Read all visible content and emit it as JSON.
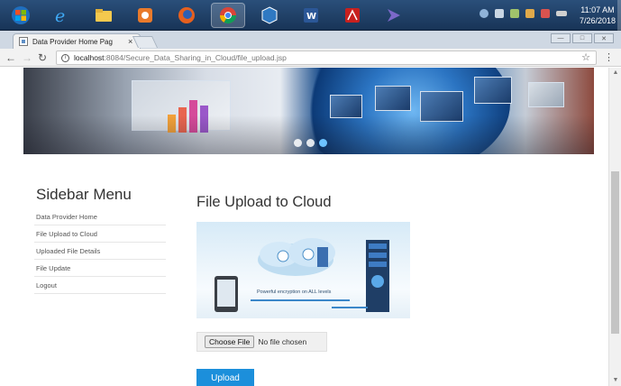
{
  "taskbar": {
    "clock_time": "11:07 AM",
    "clock_date": "7/26/2018"
  },
  "browser": {
    "tab_title": "Data Provider Home Pag",
    "tab_close": "×",
    "url_host": "localhost",
    "url_path": ":8084/Secure_Data_Sharing_in_Cloud/file_upload.jsp"
  },
  "sidebar": {
    "title": "Sidebar Menu",
    "items": [
      {
        "label": "Data Provider Home"
      },
      {
        "label": "File Upload to Cloud"
      },
      {
        "label": "Uploaded File Details"
      },
      {
        "label": "File Update"
      },
      {
        "label": "Logout"
      }
    ]
  },
  "main": {
    "title": "File Upload to Cloud",
    "image_caption": "Powerful encryption on ALL levels",
    "choose_file_label": "Choose File",
    "no_file_text": "No file chosen",
    "upload_label": "Upload"
  }
}
